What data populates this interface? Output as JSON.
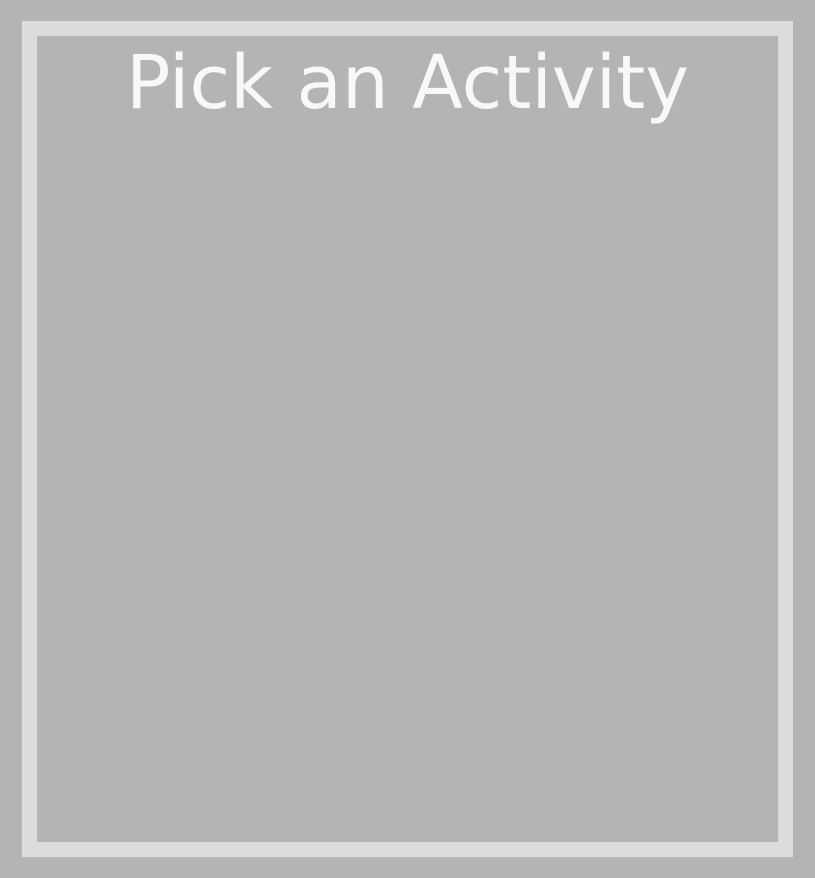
{
  "dialog": {
    "title": "Pick an Activity"
  },
  "colors": {
    "background": "#b4b4b4",
    "frame_border": "#dcdcdc",
    "title_text": "#f8f8f8"
  }
}
